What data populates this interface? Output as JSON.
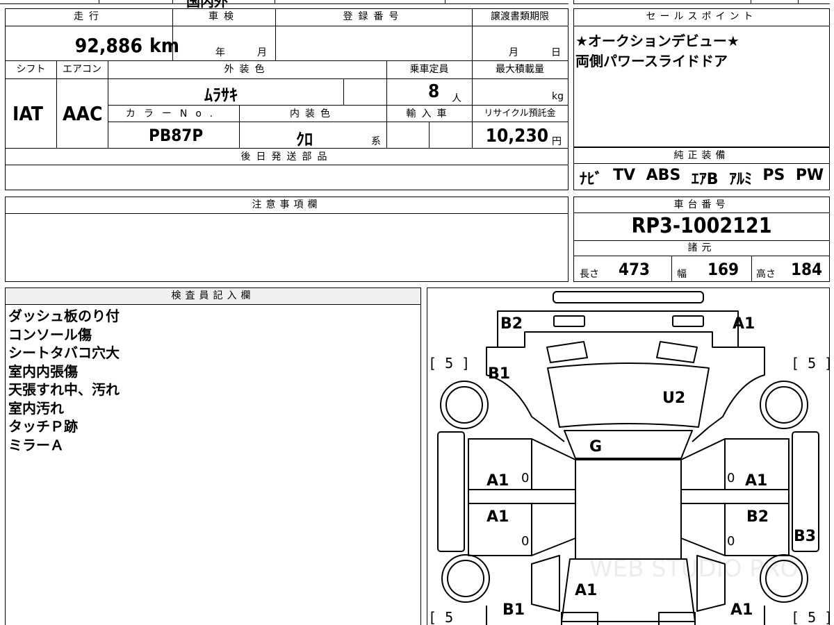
{
  "top_strip": {
    "partial_text": "国内外"
  },
  "vehicle": {
    "headers": {
      "mileage": "走行",
      "inspection": "車検",
      "registration": "登録番号",
      "transfer_deadline": "譲渡書類期限",
      "shift": "シフト",
      "aircon": "エアコン",
      "exterior_color": "外装色",
      "capacity": "乗車定員",
      "max_load": "最大積載量",
      "color_no": "カラーNo.",
      "interior_color": "内装色",
      "import": "輸入車",
      "recycle_fee": "リサイクル預託金",
      "later_parts": "後日発送部品"
    },
    "mileage_value": "92,886",
    "mileage_unit": "km",
    "year_unit": "年",
    "month_unit": "月",
    "deadline_month": "月",
    "deadline_day": "日",
    "shift_value": "IAT",
    "aircon_value": "AAC",
    "exterior_color_value": "ﾑﾗｻｷ",
    "capacity_value": "8",
    "capacity_unit": "人",
    "max_load_unit": "kg",
    "color_no_value": "PB87P",
    "interior_color_value": "ｸﾛ",
    "interior_suffix": "系",
    "recycle_value": "10,230",
    "recycle_unit": "円"
  },
  "sales_points": {
    "header": "セールスポイント",
    "lines": [
      "★オークションデビュー★",
      "両側パワースライドドア"
    ]
  },
  "equipment": {
    "header": "純正装備",
    "items": [
      "ﾅﾋﾞ",
      "TV",
      "ABS",
      "ｴｱB",
      "ｱﾙﾐ",
      "PS",
      "PW"
    ]
  },
  "notes": {
    "header": "注意事項欄"
  },
  "chassis": {
    "header": "車台番号",
    "value": "RP3-1002121"
  },
  "specs": {
    "header": "諸元",
    "length_label": "長さ",
    "length_value": "473",
    "width_label": "幅",
    "width_value": "169",
    "height_label": "高さ",
    "height_value": "184"
  },
  "inspector": {
    "header": "検査員記入欄",
    "notes": [
      "ダッシュ板のり付",
      "コンソール傷",
      "シートタバコ穴大",
      "室内内張傷",
      "天張すれ中、汚れ",
      "室内汚れ",
      "タッチＰ跡",
      "ミラーＡ"
    ]
  },
  "diagram": {
    "labels": {
      "b2_top": "B2",
      "a1_top": "A1",
      "b1_left": "B1",
      "u2": "U2",
      "g": "G",
      "a1_left_upper": "A1",
      "a1_right_upper": "A1",
      "a1_left_lower": "A1",
      "b2_right_lower": "B2",
      "b3_right": "B3",
      "a1_bottom_center": "A1",
      "b1_bottom_left": "B1",
      "a1_bottom_right": "A1"
    },
    "zeros": [
      "0",
      "0",
      "0",
      "0"
    ],
    "tire_brackets": [
      "[ 5 ]",
      "[ 5 ]",
      "[ 5",
      "[ 5 ]"
    ],
    "watermark": "WEB STUDIO PRO"
  }
}
